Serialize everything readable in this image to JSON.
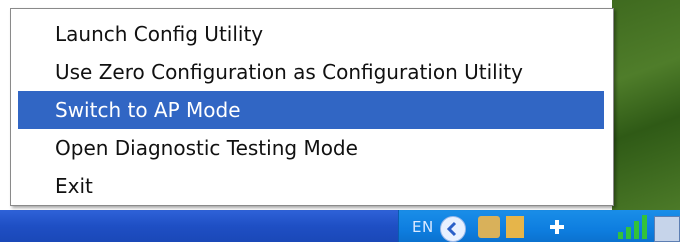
{
  "menu": {
    "items": [
      {
        "label": "Launch Config Utility",
        "selected": false
      },
      {
        "label": "Use Zero Configuration as Configuration Utility",
        "selected": false
      },
      {
        "label": "Switch to AP Mode",
        "selected": true
      },
      {
        "label": "Open Diagnostic Testing Mode",
        "selected": false
      },
      {
        "label": "Exit",
        "selected": false
      }
    ]
  },
  "taskbar": {
    "language": "EN",
    "tray_icons": [
      "show-hidden-icons-chevron-icon",
      "network-adapter-icon",
      "safely-remove-icon",
      "wireless-signal-icon",
      "network-connection-icon"
    ]
  },
  "colors": {
    "highlight": "#3166c4",
    "taskbar": "#1f4fc4",
    "tray": "#0e7ee0",
    "signal": "#33c23a"
  }
}
